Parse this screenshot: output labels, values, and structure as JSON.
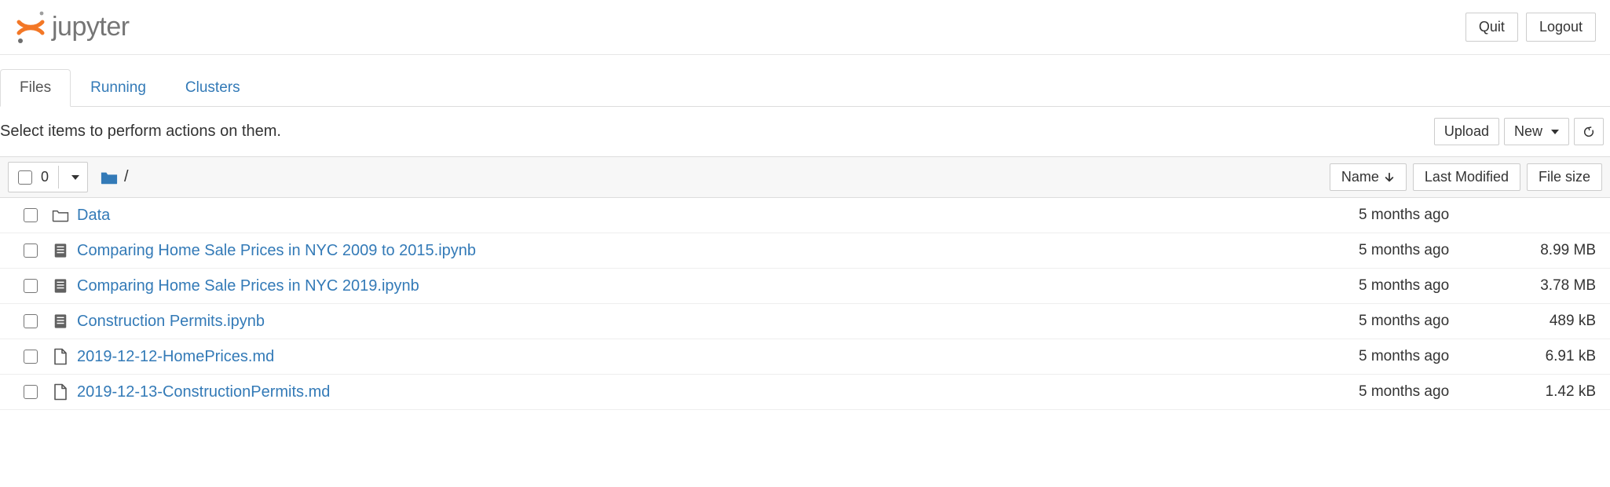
{
  "header": {
    "logo_text": "jupyter",
    "quit": "Quit",
    "logout": "Logout"
  },
  "tabs": [
    {
      "label": "Files",
      "active": true
    },
    {
      "label": "Running",
      "active": false
    },
    {
      "label": "Clusters",
      "active": false
    }
  ],
  "toolbar": {
    "hint": "Select items to perform actions on them.",
    "upload": "Upload",
    "new": "New",
    "refresh_title": "Refresh"
  },
  "list_header": {
    "selected_count": "0",
    "breadcrumb_root": "/",
    "name_col": "Name",
    "modified_col": "Last Modified",
    "size_col": "File size"
  },
  "rows": [
    {
      "type": "folder",
      "name": "Data",
      "modified": "5 months ago",
      "size": ""
    },
    {
      "type": "notebook",
      "name": "Comparing Home Sale Prices in NYC 2009 to 2015.ipynb",
      "modified": "5 months ago",
      "size": "8.99 MB"
    },
    {
      "type": "notebook",
      "name": "Comparing Home Sale Prices in NYC 2019.ipynb",
      "modified": "5 months ago",
      "size": "3.78 MB"
    },
    {
      "type": "notebook",
      "name": "Construction Permits.ipynb",
      "modified": "5 months ago",
      "size": "489 kB"
    },
    {
      "type": "file",
      "name": "2019-12-12-HomePrices.md",
      "modified": "5 months ago",
      "size": "6.91 kB"
    },
    {
      "type": "file",
      "name": "2019-12-13-ConstructionPermits.md",
      "modified": "5 months ago",
      "size": "1.42 kB"
    }
  ]
}
